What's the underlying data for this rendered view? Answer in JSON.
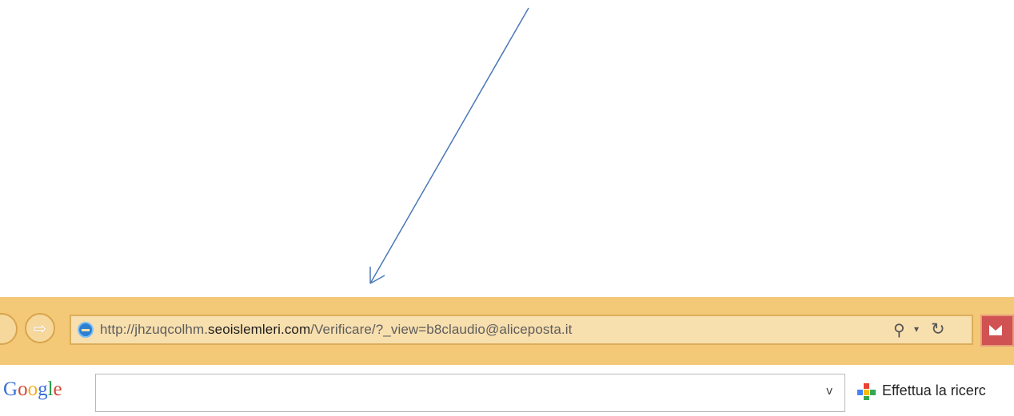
{
  "address_bar": {
    "url_prefix": "http://jhzuqcolhm.",
    "url_domain": "seoislemleri.com",
    "url_path": "/Verificare/?_view=b8claudio@aliceposta.it"
  },
  "icons": {
    "forward": "forward-arrow-icon",
    "site": "ie-page-icon",
    "search": "search-icon",
    "refresh": "refresh-icon",
    "mail": "mail-icon",
    "apps": "google-apps-icon"
  },
  "google_toolbar": {
    "logo": "Google",
    "search_value": "",
    "search_label": "Effettua la ricerc"
  },
  "colors": {
    "browser_bar": "#f3c877",
    "arrow": "#4a78b6"
  }
}
